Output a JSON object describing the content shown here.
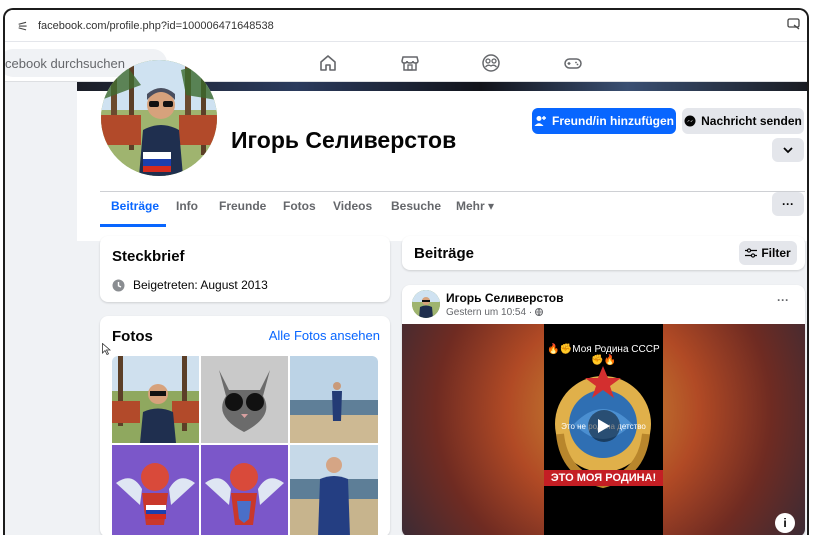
{
  "browser": {
    "url": "facebook.com/profile.php?id=100006471648538"
  },
  "topnav": {
    "search_placeholder": "cebook durchsuchen",
    "icons": [
      "home-icon",
      "marketplace-icon",
      "groups-icon",
      "gaming-icon"
    ]
  },
  "profile": {
    "name": "Игорь Селиверстов",
    "add_friend_label": "Freund/in hinzufügen",
    "message_label": "Nachricht senden"
  },
  "tabs": [
    {
      "label": "Beiträge",
      "active": true
    },
    {
      "label": "Info",
      "active": false
    },
    {
      "label": "Freunde",
      "active": false
    },
    {
      "label": "Fotos",
      "active": false
    },
    {
      "label": "Videos",
      "active": false
    },
    {
      "label": "Besuche",
      "active": false
    },
    {
      "label": "Mehr ▾",
      "active": false
    }
  ],
  "more_label": "···",
  "intro": {
    "title": "Steckbrief",
    "joined": "Beigetreten: August 2013"
  },
  "photos": {
    "title": "Fotos",
    "see_all": "Alle Fotos ansehen"
  },
  "posts": {
    "title": "Beiträge",
    "filter_label": "Filter",
    "post": {
      "author": "Игорь Селиверстов",
      "time": "Gestern um 10:54 · ",
      "dots": "···",
      "media_title": "🔥✊Моя Родина СССР✊🔥",
      "media_mid": "Это не родина детство",
      "media_banner": "ЭТО МОЯ РОДИНА!",
      "info": "i"
    }
  },
  "colors": {
    "accent": "#0866ff",
    "background": "#f0f2f5",
    "secondary_button": "#e4e6eb"
  }
}
